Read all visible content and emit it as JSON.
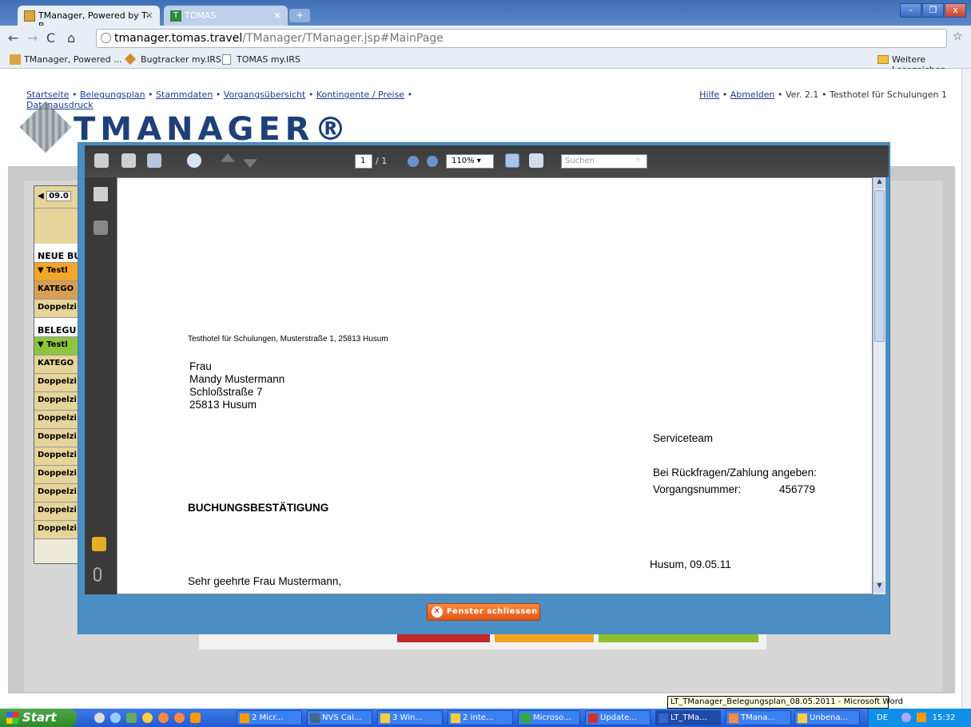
{
  "browser": {
    "tabs": [
      {
        "label": "TManager, Powered by T-B...",
        "close": "×"
      },
      {
        "label": "TOMAS",
        "close": "×"
      }
    ],
    "new_tab": "+",
    "window_buttons": [
      "–",
      "❐",
      "x"
    ],
    "url_host": "tmanager.tomas.travel",
    "url_path": "/TManager/TManager.jsp#MainPage",
    "star_icon": "☆",
    "wrench_icon": "🔧",
    "bookmarks": [
      {
        "label": "TManager, Powered ..."
      },
      {
        "label": "Bugtracker my.IRS"
      },
      {
        "label": "TOMAS my.IRS"
      }
    ],
    "other_bookmarks": "Weitere Lesezeichen"
  },
  "app": {
    "nav": [
      "Startseite",
      "Belegungsplan",
      "Stammdaten",
      "Vorgangsübersicht",
      "Kontingente / Preise",
      "Datenausdruck"
    ],
    "separator": "•",
    "help": "Hilfe",
    "logout": "Abmelden",
    "version": "Ver. 2.1",
    "hotel": "Testhotel für Schulungen 1",
    "logo_text": "TMANAGER®",
    "date_short": "09.0",
    "left_list": [
      {
        "label": "NEUE BU",
        "kind": "header"
      },
      {
        "label": "▼ Testl",
        "kind": "orange"
      },
      {
        "label": "KATEGO",
        "kind": "orange-dark"
      },
      {
        "label": "Doppelzi",
        "kind": "row"
      },
      {
        "label": "BELEGU",
        "kind": "header"
      },
      {
        "label": "▼ Testl",
        "kind": "green"
      },
      {
        "label": "KATEGO",
        "kind": "row"
      },
      {
        "label": "Doppelzi",
        "kind": "row"
      },
      {
        "label": "Doppelzi",
        "kind": "row"
      },
      {
        "label": "Doppelzi",
        "kind": "row"
      },
      {
        "label": "Doppelzi",
        "kind": "row"
      },
      {
        "label": "Doppelzi",
        "kind": "row"
      },
      {
        "label": "Doppelzi",
        "kind": "row"
      },
      {
        "label": "Doppelzi",
        "kind": "row"
      },
      {
        "label": "Doppelzi",
        "kind": "row"
      },
      {
        "label": "Doppelzi",
        "kind": "row"
      }
    ]
  },
  "pdf": {
    "page_current": "1",
    "page_total": "/ 1",
    "zoom": "110%",
    "search_placeholder": "Suchen",
    "doc": {
      "sender_line": "Testhotel für Schulungen, Musterstraße 1, 25813 Husum",
      "recipient": [
        "Frau",
        "Mandy Mustermann",
        "Schloßstraße 7",
        "25813 Husum"
      ],
      "serviceteam": "Serviceteam",
      "reference_hint": "Bei Rückfragen/Zahlung angeben:",
      "vorgang_label": "Vorgangsnummer:",
      "vorgang_value": "456779",
      "title": "BUCHUNGSBESTÄTIGUNG",
      "date_line": "Husum, 09.05.11",
      "salutation": "Sehr geehrte Frau Mustermann,"
    }
  },
  "modal": {
    "close_label": "Fenster schliessen"
  },
  "tooltip": "LT_TManager_Belegungsplan_08.05.2011 - Microsoft Word",
  "taskbar": {
    "start": "Start",
    "items": [
      "2 Micr...",
      "NVS Cal...",
      "3 Win...",
      "2 Inte...",
      "Microso...",
      "Update...",
      "LT_TMa...",
      "TMana...",
      "Unbena..."
    ],
    "lang": "DE",
    "time": "15:32"
  },
  "colors": {
    "modal_blue": "#4a8ec4",
    "close_orange": "#e0561a",
    "link_blue": "#1a3d8f"
  }
}
